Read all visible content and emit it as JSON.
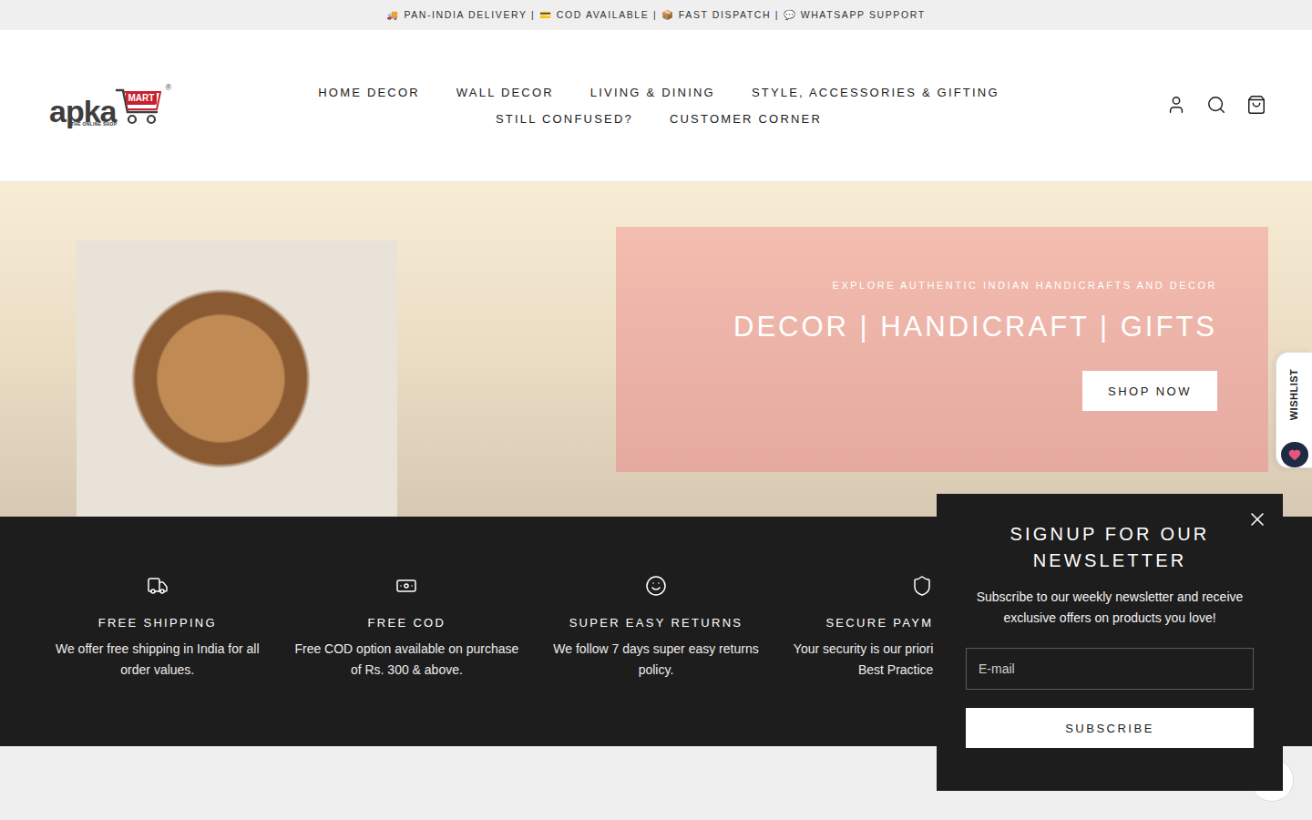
{
  "announcement": "🚚 PAN-INDIA DELIVERY | 💳 COD AVAILABLE | 📦 FAST DISPATCH | 💬 WHATSAPP SUPPORT",
  "logo": {
    "word": "apka",
    "badge": "MART",
    "tagline": "THE ONLINE SHOP",
    "mark": "®"
  },
  "nav": [
    {
      "label": "HOME DECOR"
    },
    {
      "label": "WALL DECOR"
    },
    {
      "label": "LIVING & DINING"
    },
    {
      "label": "STYLE, ACCESSORIES & GIFTING"
    },
    {
      "label": "STILL CONFUSED?"
    },
    {
      "label": "CUSTOMER CORNER"
    }
  ],
  "hero": {
    "eyebrow": "EXPLORE AUTHENTIC INDIAN HANDICRAFTS AND DECOR",
    "title": "DECOR | HANDICRAFT | GIFTS",
    "button": "SHOP NOW"
  },
  "features": [
    {
      "title": "FREE SHIPPING",
      "lines": [
        "We offer free shipping in India for all",
        "order values."
      ],
      "clipped": false
    },
    {
      "title": "FREE COD",
      "lines": [
        "Free COD option available on purchase",
        "of Rs. 300 & above."
      ],
      "clipped": false
    },
    {
      "title": "SUPER EASY RETURNS",
      "lines": [
        "We follow 7 days super easy returns",
        "policy."
      ],
      "clipped": false
    },
    {
      "title": "SECURE PAYM",
      "lines": [
        "Your security is our priori",
        "Best Practice"
      ],
      "clipped": true
    }
  ],
  "wishlist": {
    "label": "WISHLIST"
  },
  "newsletter": {
    "title": "SIGNUP FOR OUR NEWSLETTER",
    "lines": [
      "Subscribe to our weekly newsletter and receive",
      "exclusive offers on products you love!"
    ],
    "placeholder": "E-mail",
    "button": "SUBSCRIBE"
  }
}
